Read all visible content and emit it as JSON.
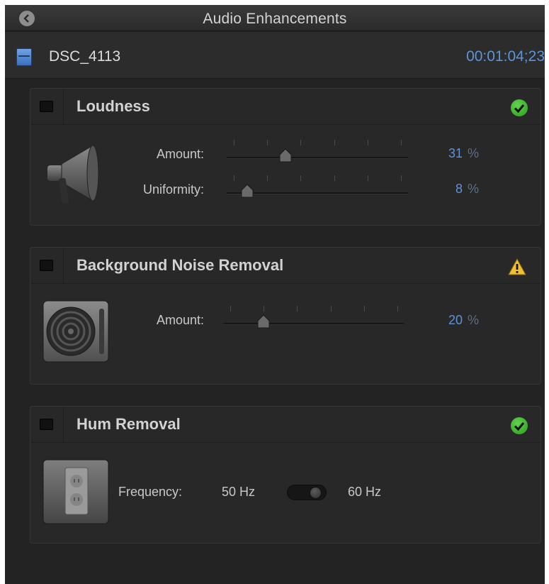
{
  "window": {
    "title": "Audio Enhancements"
  },
  "clip": {
    "name": "DSC_4113",
    "timecode": "00:01:04;23"
  },
  "colors": {
    "accent_blue": "#5e93d8",
    "ok_green": "#3fb22f",
    "warn_yellow": "#f0c030"
  },
  "panels": {
    "loudness": {
      "title": "Loudness",
      "status_icon": "check-circle-icon",
      "amount": {
        "label": "Amount:",
        "value": "31",
        "unit": "%",
        "level": 0.31
      },
      "uniformity": {
        "label": "Uniformity:",
        "value": "8",
        "unit": "%",
        "level": 0.08
      }
    },
    "noise": {
      "title": "Background Noise Removal",
      "status_icon": "warning-icon",
      "amount": {
        "label": "Amount:",
        "value": "20",
        "unit": "%",
        "level": 0.2
      }
    },
    "hum": {
      "title": "Hum Removal",
      "status_icon": "check-circle-icon",
      "frequency": {
        "label": "Frequency:",
        "option_a": "50 Hz",
        "option_b": "60 Hz",
        "selected": "60 Hz"
      }
    }
  }
}
